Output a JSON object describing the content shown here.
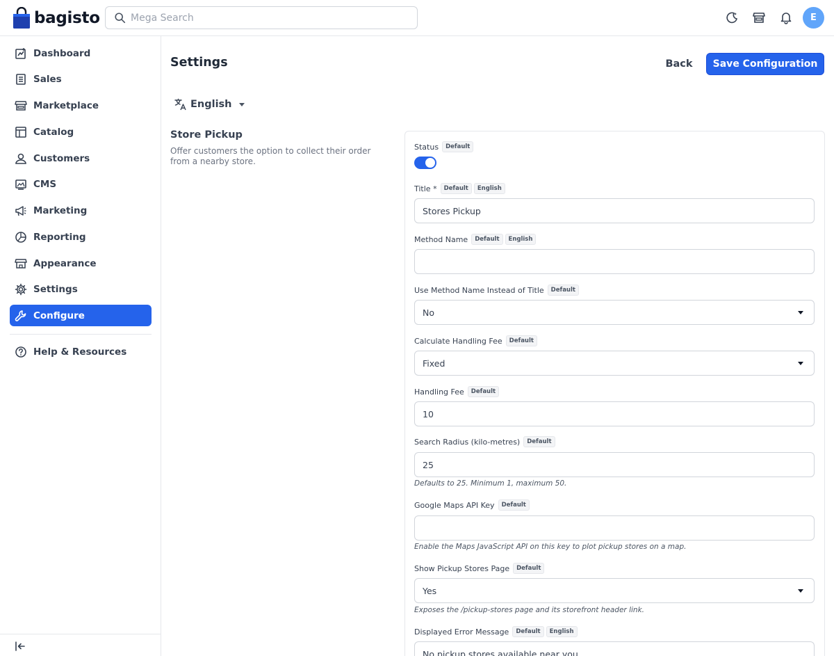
{
  "brand": {
    "name": "bagisto",
    "color": "#1e40af"
  },
  "search": {
    "placeholder": "Mega Search"
  },
  "topbar_icons": [
    "dark-mode-icon",
    "storefront-icon",
    "notification-bell-icon"
  ],
  "user": {
    "initial": "E",
    "avatar_color": "#60a5fa"
  },
  "sidebar": {
    "items": [
      {
        "label": "Dashboard",
        "icon": "dashboard-icon"
      },
      {
        "label": "Sales",
        "icon": "sales-icon"
      },
      {
        "label": "Marketplace",
        "icon": "marketplace-icon"
      },
      {
        "label": "Catalog",
        "icon": "catalog-icon"
      },
      {
        "label": "Customers",
        "icon": "customers-icon"
      },
      {
        "label": "CMS",
        "icon": "cms-icon"
      },
      {
        "label": "Marketing",
        "icon": "marketing-icon"
      },
      {
        "label": "Reporting",
        "icon": "reporting-icon"
      },
      {
        "label": "Appearance",
        "icon": "appearance-icon"
      },
      {
        "label": "Settings",
        "icon": "settings-icon"
      },
      {
        "label": "Configure",
        "icon": "configure-icon",
        "active": true
      }
    ],
    "help": {
      "label": "Help & Resources",
      "icon": "help-icon"
    },
    "collapse_icon": "collapse-sidebar-icon",
    "active_color": "#2563eb"
  },
  "header": {
    "title": "Settings",
    "back_label": "Back",
    "save_label": "Save Configuration"
  },
  "locale": {
    "label": "English",
    "icon": "translate-icon"
  },
  "section": {
    "title": "Store Pickup",
    "description": "Offer customers the option to collect their order from a nearby store."
  },
  "badges": {
    "default": "Default",
    "english": "English"
  },
  "fields": {
    "status": {
      "label": "Status",
      "value": "on"
    },
    "title": {
      "label": "Title *",
      "value": "Stores Pickup"
    },
    "method_name": {
      "label": "Method Name",
      "value": ""
    },
    "use_method_name": {
      "label": "Use Method Name Instead of Title",
      "value": "No"
    },
    "handling_type": {
      "label": "Calculate Handling Fee",
      "value": "Fixed"
    },
    "handling_fee": {
      "label": "Handling Fee",
      "value": "10"
    },
    "search_radius": {
      "label": "Search Radius (kilo-metres)",
      "value": "25",
      "hint": "Defaults to 25. Minimum 1, maximum 50."
    },
    "maps_key": {
      "label": "Google Maps API Key",
      "value": "",
      "hint": "Enable the Maps JavaScript API on this key to plot pickup stores on a map."
    },
    "show_page": {
      "label": "Show Pickup Stores Page",
      "value": "Yes",
      "hint": "Exposes the /pickup-stores page and its storefront header link."
    },
    "error_message": {
      "label": "Displayed Error Message",
      "value": "No pickup stores available near you."
    }
  }
}
